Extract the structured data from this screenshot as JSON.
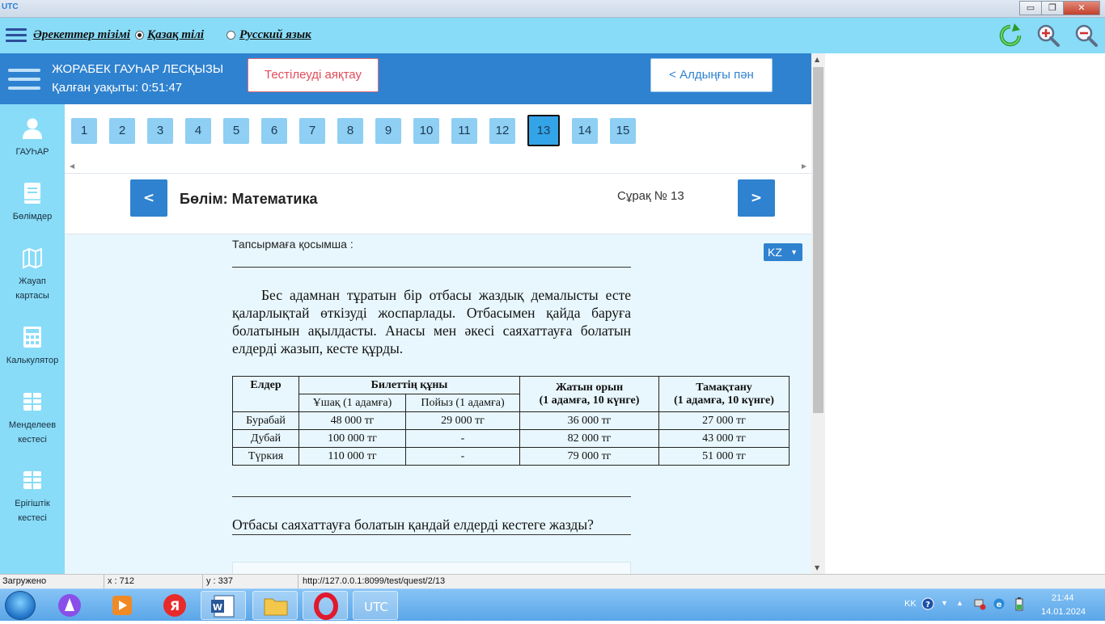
{
  "window": {
    "app_logo": "UTC",
    "minimize": "▭",
    "maximize": "❐",
    "close": "✕"
  },
  "toolbar": {
    "actions_list": "Әрекеттер тізімі",
    "lang_kz": "Қазақ тілі",
    "lang_ru": "Русский язык",
    "selected_lang": "kz"
  },
  "header": {
    "student_name": "ЖОРАБЕК ГАУҺАР ЛЕСҚЫЗЫ",
    "time_left": "Қалған уақыты: 0:51:47",
    "finish_button": "Тестілеуді аяқтау",
    "prev_subject_button": "< Алдыңғы пән"
  },
  "sidebar": {
    "items": [
      {
        "label": "ГАУҺАР",
        "icon": "user-icon"
      },
      {
        "label": "Бөлімдер",
        "icon": "book-icon"
      },
      {
        "label": "Жауап картасы",
        "icon": "map-icon"
      },
      {
        "label": "Калькулятор",
        "icon": "calculator-icon"
      },
      {
        "label": "Менделеев кестесі",
        "icon": "grid-icon"
      },
      {
        "label": "Ерігіштік кестесі",
        "icon": "grid-icon"
      }
    ]
  },
  "questions": {
    "numbers": [
      "1",
      "2",
      "3",
      "4",
      "5",
      "6",
      "7",
      "8",
      "9",
      "10",
      "11",
      "12",
      "13",
      "14",
      "15"
    ],
    "active": "13"
  },
  "section": {
    "prev": "<",
    "next": ">",
    "title": "Бөлім: Математика",
    "question_label": "Сұрақ № 13"
  },
  "content": {
    "supplement_label": "Тапсырмаға қосымша :",
    "language": "KZ",
    "paragraph": "Бес адамнан тұратын бір отбасы жаздық демалысты есте қаларлықтай өткізуді жоспарлады. Отбасымен қайда баруға болатынын ақылдасты. Анасы мен әкесі саяхаттауға болатын елдерді жазып, кесте құрды.",
    "table": {
      "h_country": "Елдер",
      "h_ticket": "Билеттің құны",
      "h_plane": "Ұшақ (1 адамға)",
      "h_train": "Пойыз (1 адамға)",
      "h_bed_1": "Жатын орын",
      "h_bed_2": "(1 адамға, 10 күнге)",
      "h_food_1": "Тамақтану",
      "h_food_2": "(1 адамға, 10 күнге)",
      "rows": [
        {
          "country": "Бурабай",
          "plane": "48 000 тг",
          "train": "29 000 тг",
          "bed": "36 000 тг",
          "food": "27 000 тг"
        },
        {
          "country": "Дубай",
          "plane": "100 000 тг",
          "train": "-",
          "bed": "82 000 тг",
          "food": "43 000 тг"
        },
        {
          "country": "Түркия",
          "plane": "110 000 тг",
          "train": "-",
          "bed": "79 000 тг",
          "food": "51 000 тг"
        }
      ]
    },
    "question": "Отбасы саяхаттауға болатын қандай елдерді кестеге жазды?"
  },
  "statusbar": {
    "status": "Загружено",
    "x": "x : 712",
    "y": "y : 337",
    "url": "http://127.0.0.1:8099/test/quest/2/13"
  },
  "taskbar": {
    "lang": "KK",
    "time": "21:44",
    "date": "14.01.2024"
  },
  "colors": {
    "accent": "#2f82cf",
    "toolbar_bg": "#88dcf8",
    "content_bg": "#e8f7fd",
    "active_q": "#34a4e8"
  }
}
